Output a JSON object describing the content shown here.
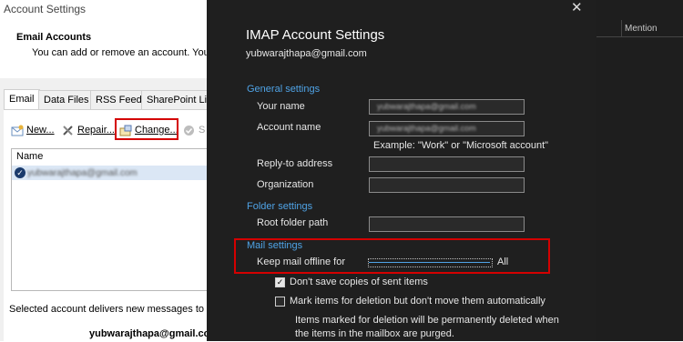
{
  "account_settings": {
    "window_title": "Account Settings",
    "heading": "Email Accounts",
    "subtitle": "You can add or remove an account. You ca",
    "tabs": [
      "Email",
      "Data Files",
      "RSS Feeds",
      "SharePoint List"
    ],
    "toolbar": {
      "new_label": "New...",
      "repair_label": "Repair...",
      "change_label": "Change...",
      "s_label": "S"
    },
    "list_header": "Name",
    "account_row": "yubwarajthapa@gmail.com",
    "delivers_text": "Selected account delivers new messages to the f",
    "deliver_email": "yubwarajthapa@gmail.com"
  },
  "behind_window": {
    "column_header": "Mention"
  },
  "imap": {
    "title": "IMAP Account Settings",
    "email": "yubwarajthapa@gmail.com",
    "general_settings": "General settings",
    "your_name_label": "Your name",
    "your_name_value": "yubwarajthapa@gmail.com",
    "account_name_label": "Account name",
    "account_name_value": "yubwarajthapa@gmail.com",
    "example": "Example: \"Work\" or \"Microsoft account\"",
    "reply_to_label": "Reply-to address",
    "organization_label": "Organization",
    "folder_settings": "Folder settings",
    "root_folder_label": "Root folder path",
    "mail_settings": "Mail settings",
    "keep_offline_label": "Keep mail offline for",
    "keep_offline_value": "All",
    "dont_save_label": "Don't save copies of sent items",
    "dont_save_checked": true,
    "mark_delete_label": "Mark items for deletion but don't move them automatically",
    "mark_delete_checked": false,
    "note": "Items marked for deletion will be permanently deleted when the items in the mailbox are purged."
  }
}
